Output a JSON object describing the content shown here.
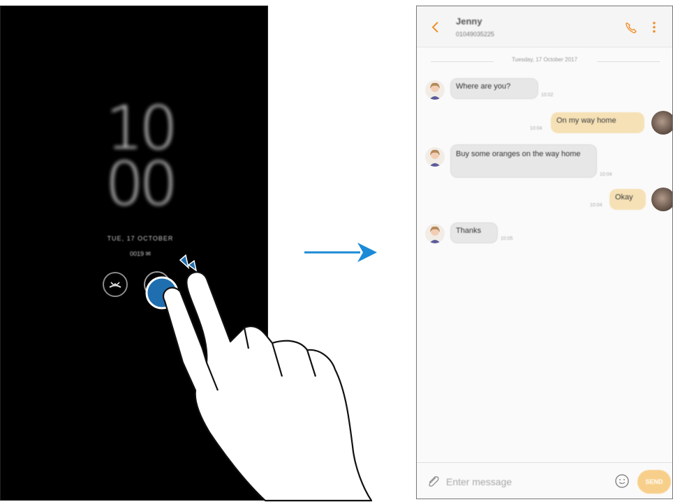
{
  "always_on": {
    "clock_hours": "10",
    "clock_minutes": "00",
    "date": "TUE, 17 OCTOBER",
    "caller_line": "0019 ✉"
  },
  "conversation": {
    "contact_name": "Jenny",
    "contact_number": "01049035225",
    "date_divider": "Tuesday, 17 October 2017",
    "messages": [
      {
        "direction": "in",
        "text": "Where are you?",
        "time": "10:02"
      },
      {
        "direction": "out",
        "text": "On my way home",
        "time": "10:04"
      },
      {
        "direction": "in",
        "text": "Buy some oranges on the way home",
        "time": "10:04"
      },
      {
        "direction": "out",
        "text": "Okay",
        "time": "10:04"
      },
      {
        "direction": "in",
        "text": "Thanks",
        "time": "10:05"
      }
    ]
  },
  "composer": {
    "placeholder": "Enter message",
    "send_label": "SEND"
  },
  "icons": {
    "back": "chevron-left-icon",
    "call": "phone-icon",
    "more": "more-vertical-icon",
    "attach": "paperclip-icon",
    "emoji": "smiley-icon",
    "reject": "call-reject-icon"
  },
  "colors": {
    "accent": "#f0902a",
    "arrow": "#1c8ad6",
    "incoming_bubble": "#e7e7e7",
    "outgoing_bubble": "#f6e1b6",
    "tap_circle": "#1f6fb0"
  }
}
